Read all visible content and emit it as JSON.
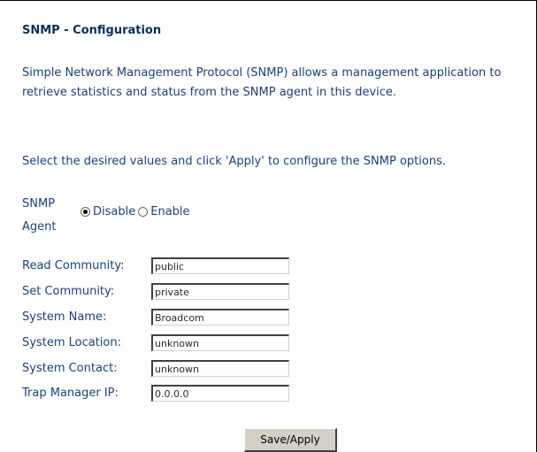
{
  "page": {
    "title": "SNMP - Configuration",
    "description": "Simple Network Management Protocol (SNMP) allows a management application to retrieve statistics and status from the SNMP agent in this device.",
    "instruction": "Select the desired values and click 'Apply' to configure the SNMP options."
  },
  "agent": {
    "label": "SNMP Agent",
    "options": [
      {
        "label": "Disable",
        "checked": true
      },
      {
        "label": "Enable",
        "checked": false
      }
    ]
  },
  "fields": [
    {
      "label": "Read Community:",
      "value": "public"
    },
    {
      "label": "Set Community:",
      "value": "private"
    },
    {
      "label": "System Name:",
      "value": "Broadcom"
    },
    {
      "label": "System Location:",
      "value": "unknown"
    },
    {
      "label": "System Contact:",
      "value": "unknown"
    },
    {
      "label": "Trap Manager IP:",
      "value": "0.0.0.0"
    }
  ],
  "actions": {
    "apply_label": "Save/Apply"
  }
}
